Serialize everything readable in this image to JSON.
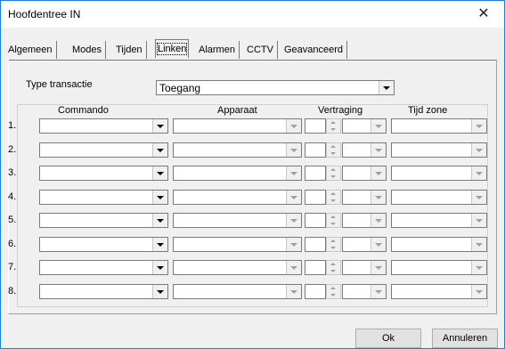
{
  "window": {
    "title": "Hoofdentree IN",
    "close_glyph": "✕"
  },
  "tabs": [
    {
      "label": "Algemeen",
      "active": false
    },
    {
      "label": "Modes",
      "active": false
    },
    {
      "label": "Tijden",
      "active": false
    },
    {
      "label": "Linken",
      "active": true
    },
    {
      "label": "Alarmen",
      "active": false
    },
    {
      "label": "CCTV",
      "active": false
    },
    {
      "label": "Geavanceerd",
      "active": false
    }
  ],
  "type_transactie": {
    "label": "Type transactie",
    "value": "Toegang"
  },
  "columns": {
    "commando": "Commando",
    "apparaat": "Apparaat",
    "vertraging": "Vertraging",
    "tijd_zone": "Tijd zone"
  },
  "rows": [
    {
      "num": "1."
    },
    {
      "num": "2."
    },
    {
      "num": "3."
    },
    {
      "num": "4."
    },
    {
      "num": "5."
    },
    {
      "num": "6."
    },
    {
      "num": "7."
    },
    {
      "num": "8."
    }
  ],
  "buttons": {
    "ok": "Ok",
    "cancel": "Annuleren"
  },
  "colors": {
    "window_border": "#1c7ed6",
    "dialog_bg": "#f0f0f0"
  }
}
